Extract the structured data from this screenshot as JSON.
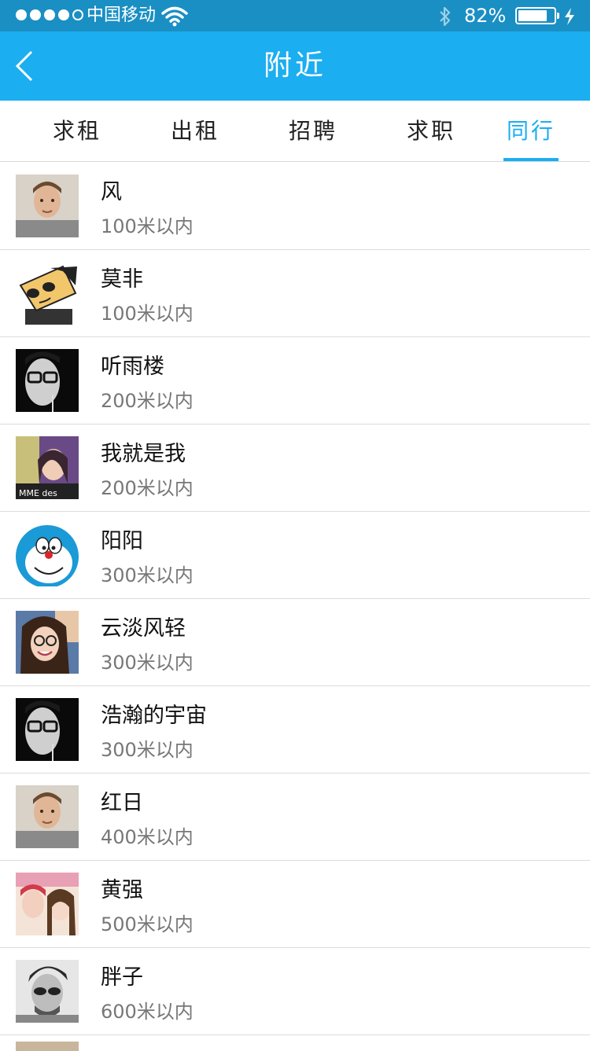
{
  "status_bar": {
    "carrier": "中国移动",
    "battery_percent": "82%",
    "battery_level": 0.82
  },
  "nav": {
    "title": "附近"
  },
  "tabs": [
    {
      "label": "求租",
      "active": false
    },
    {
      "label": "出租",
      "active": false
    },
    {
      "label": "招聘",
      "active": false
    },
    {
      "label": "求职",
      "active": false
    },
    {
      "label": "同行",
      "active": true
    }
  ],
  "colors": {
    "status_bar": "#1a8fc4",
    "nav_bar": "#1baef0",
    "accent": "#1baef0"
  },
  "list": [
    {
      "name": "风",
      "distance": "100米以内",
      "avatar": "man-portrait-avatar"
    },
    {
      "name": "莫非",
      "distance": "100米以内",
      "avatar": "cartoon-sunglasses-avatar"
    },
    {
      "name": "听雨楼",
      "distance": "200米以内",
      "avatar": "bw-glasses-man-avatar"
    },
    {
      "name": "我就是我",
      "distance": "200米以内",
      "avatar": "girl-purple-avatar"
    },
    {
      "name": "阳阳",
      "distance": "300米以内",
      "avatar": "doraemon-avatar"
    },
    {
      "name": "云淡风轻",
      "distance": "300米以内",
      "avatar": "girl-glasses-avatar"
    },
    {
      "name": "浩瀚的宇宙",
      "distance": "300米以内",
      "avatar": "bw-glasses-man-avatar"
    },
    {
      "name": "红日",
      "distance": "400米以内",
      "avatar": "man-portrait-avatar"
    },
    {
      "name": "黄强",
      "distance": "500米以内",
      "avatar": "girls-selfie-avatar"
    },
    {
      "name": "胖子",
      "distance": "600米以内",
      "avatar": "man-sunglasses-avatar"
    }
  ]
}
